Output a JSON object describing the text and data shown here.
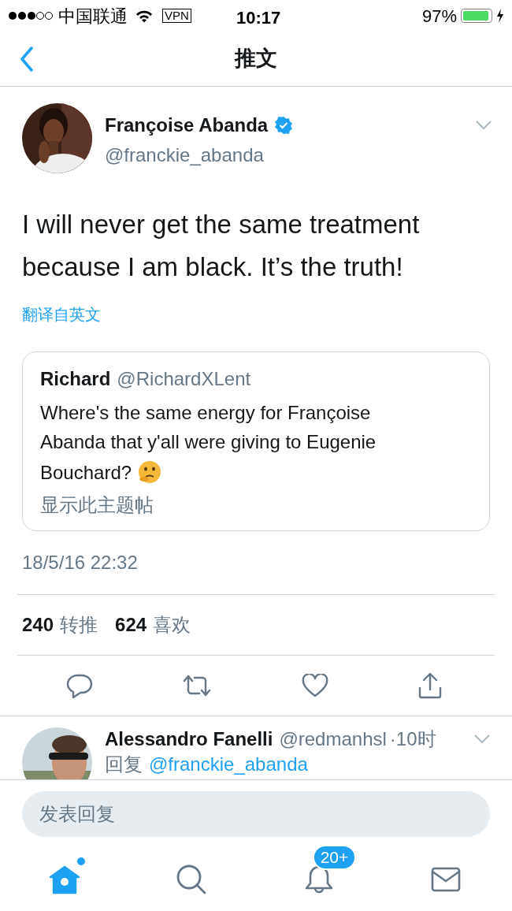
{
  "status_bar": {
    "carrier": "中国联通",
    "vpn": "VPN",
    "time": "10:17",
    "battery": "97%",
    "charging": true
  },
  "nav": {
    "title": "推文"
  },
  "tweet": {
    "name": "Françoise Abanda",
    "verified": true,
    "handle": "@franckie_abanda",
    "text": "I will never get the same treatment because I am black. It’s the truth!",
    "translate": "翻译自英文",
    "quote": {
      "name": "Richard",
      "handle": "@RichardXLent",
      "text": "Where's the same energy for Françoise Abanda that y'all were giving to Eugenie",
      "text_end": "Bouchard?",
      "show_thread": "显示此主题帖"
    },
    "timestamp": "18/5/16 22:32",
    "stats": [
      {
        "count": "240",
        "label": "转推"
      },
      {
        "count": "624",
        "label": "喜欢"
      }
    ],
    "actions": [
      {
        "kind": "reply"
      },
      {
        "kind": "retweet"
      },
      {
        "kind": "like"
      },
      {
        "kind": "share"
      }
    ]
  },
  "replies": [
    {
      "name": "Alessandro Fanelli",
      "handle": "@redmanhsl",
      "time": "·10时",
      "reply_label": "回复",
      "mention": "@franckie_abanda"
    }
  ],
  "composer": {
    "placeholder": "发表回复"
  },
  "tabs": [
    {
      "kind": "home",
      "selected": true,
      "dot": true
    },
    {
      "kind": "search",
      "selected": false
    },
    {
      "kind": "notifications",
      "selected": false,
      "badge": "20+"
    },
    {
      "kind": "messages",
      "selected": false
    }
  ]
}
